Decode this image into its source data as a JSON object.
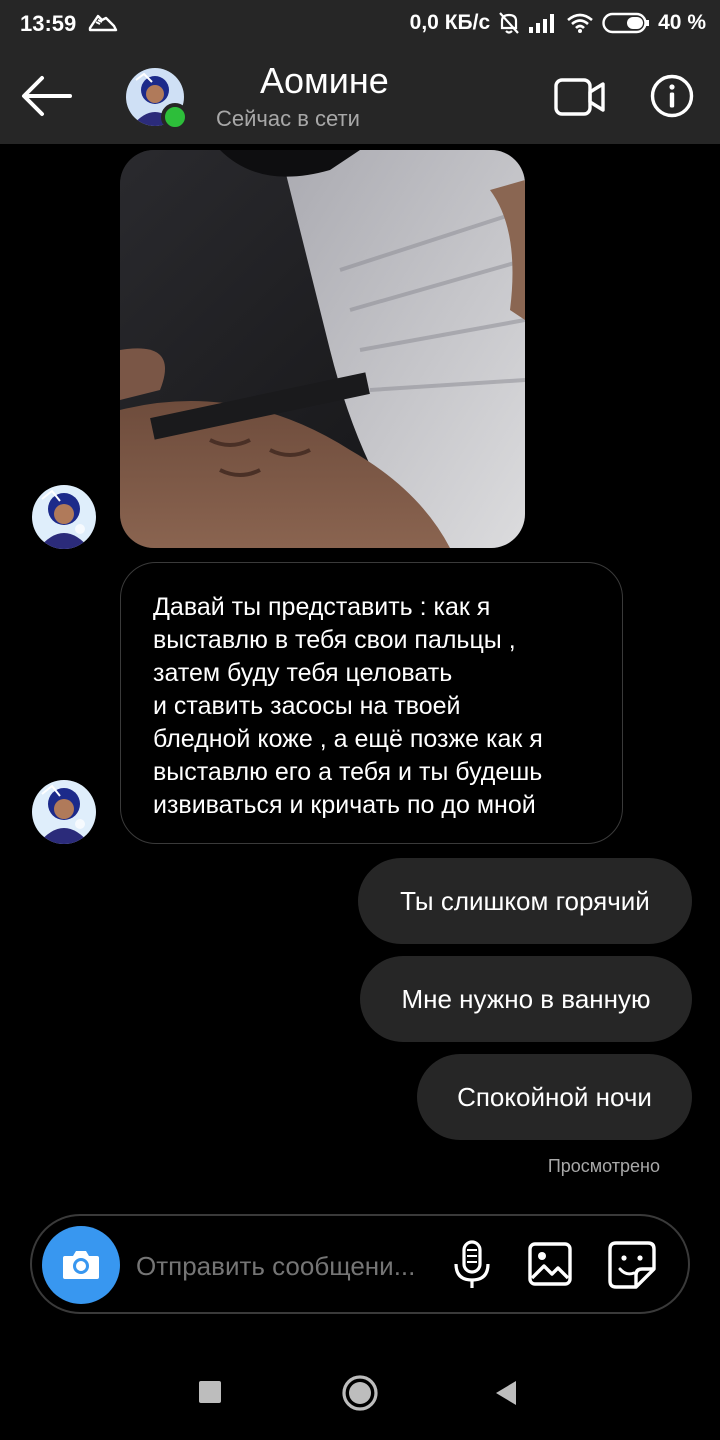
{
  "status_bar": {
    "time": "13:59",
    "network_speed": "0,0 КБ/с",
    "battery": "40 %",
    "icons": [
      "sneaker-icon",
      "mute-bell-icon",
      "signal-icon",
      "wifi-icon",
      "battery-icon"
    ]
  },
  "header": {
    "contact_name": "Аомине",
    "status": "Сейчас в сети",
    "online": true,
    "icons": [
      "back-arrow-icon",
      "video-call-icon",
      "info-icon"
    ]
  },
  "messages": {
    "received_text": "Давай ты представить : как я\nвыставлю в тебя свои пальцы ,\nзатем буду тебя целовать\nи ставить засосы на твоей\nбледной коже , а ещё позже как я\nвыставлю его а тебя и ты будешь\nизвиваться и кричать по до мной",
    "sent": [
      "Ты слишком горячий",
      "Мне нужно в ванную",
      "Спокойной ночи"
    ],
    "seen_label": "Просмотрено"
  },
  "composer": {
    "placeholder": "Отправить сообщени...",
    "icons": [
      "camera-icon",
      "microphone-icon",
      "gallery-icon",
      "sticker-icon"
    ]
  },
  "nav_bar": {
    "icons": [
      "recents-square-icon",
      "home-circle-icon",
      "back-triangle-icon"
    ]
  },
  "colors": {
    "background": "#000000",
    "header_bg": "#262626",
    "sent_bubble": "#262626",
    "online_green": "#2dbe3a",
    "camera_blue": "#3897f0",
    "muted_text": "#a8a8a8"
  }
}
